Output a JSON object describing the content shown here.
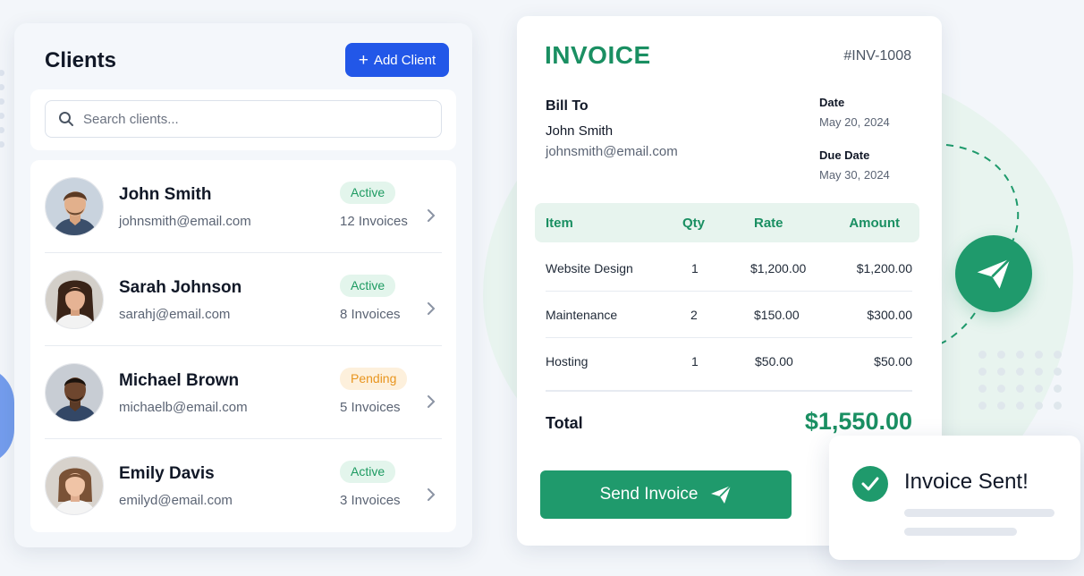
{
  "clients": {
    "title": "Clients",
    "add_button_label": "Add Client",
    "search_placeholder": "Search clients...",
    "items": [
      {
        "name": "John Smith",
        "email": "johnsmith@email.com",
        "status": "Active",
        "invoices": "12 Invoices"
      },
      {
        "name": "Sarah Johnson",
        "email": "sarahj@email.com",
        "status": "Active",
        "invoices": "8 Invoices"
      },
      {
        "name": "Michael Brown",
        "email": "michaelb@email.com",
        "status": "Pending",
        "invoices": "5 Invoices"
      },
      {
        "name": "Emily Davis",
        "email": "emilyd@email.com",
        "status": "Active",
        "invoices": "3 Invoices"
      }
    ]
  },
  "invoice": {
    "title": "INVOICE",
    "number": "#INV-1008",
    "bill_to_label": "Bill To",
    "bill_to_name": "John Smith",
    "bill_to_email": "johnsmith@email.com",
    "date_label": "Date",
    "date_value": "May 20, 2024",
    "due_label": "Due Date",
    "due_value": "May 30, 2024",
    "columns": {
      "item": "Item",
      "qty": "Qty",
      "rate": "Rate",
      "amount": "Amount"
    },
    "rows": [
      {
        "item": "Website Design",
        "qty": "1",
        "rate": "$1,200.00",
        "amount": "$1,200.00"
      },
      {
        "item": "Maintenance",
        "qty": "2",
        "rate": "$150.00",
        "amount": "$300.00"
      },
      {
        "item": "Hosting",
        "qty": "1",
        "rate": "$50.00",
        "amount": "$50.00"
      }
    ],
    "total_label": "Total",
    "total_value": "$1,550.00",
    "send_button_label": "Send Invoice"
  },
  "toast": {
    "message": "Invoice Sent!"
  },
  "colors": {
    "brand_green": "#1f9a6c",
    "primary_blue": "#2257e8",
    "active_badge": "#1e9b62",
    "pending_badge": "#e8951f"
  },
  "icons": {
    "add": "plus-icon",
    "search": "search-icon",
    "row_chevron": "chevron-right-icon",
    "send": "paper-plane-icon",
    "success": "check-circle-icon"
  }
}
